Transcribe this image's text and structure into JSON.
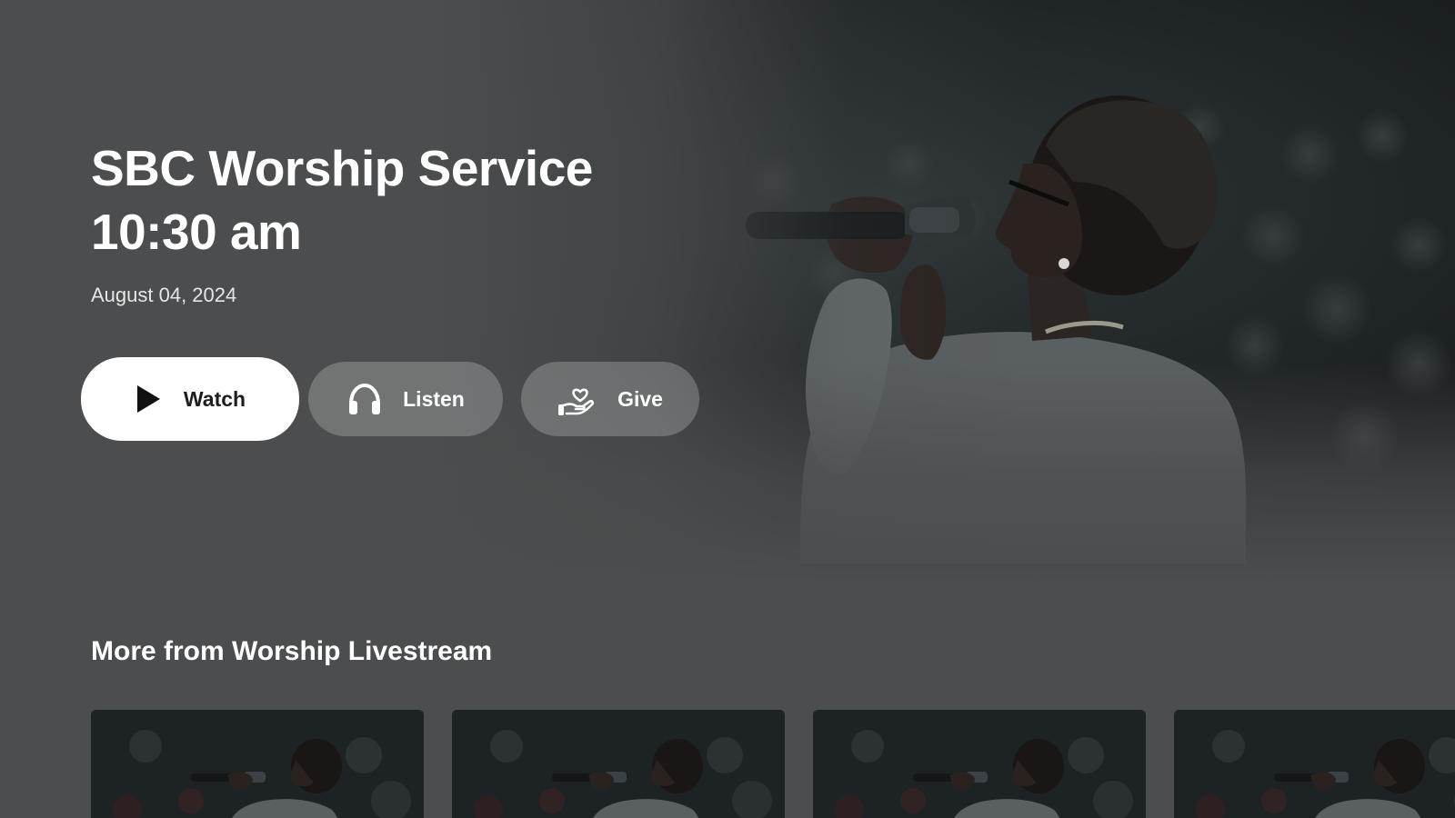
{
  "hero": {
    "title_line1": "SBC Worship Service",
    "title_line2": "10:30 am",
    "date": "August 04, 2024",
    "image": "singer-with-microphone"
  },
  "actions": {
    "watch_label": "Watch",
    "listen_label": "Listen",
    "give_label": "Give",
    "watch_icon": "play-icon",
    "listen_icon": "headphones-icon",
    "give_icon": "giving-hand-heart-icon"
  },
  "shelf": {
    "title": "More from Worship Livestream",
    "items": [
      {
        "thumbnail": "singer-with-microphone"
      },
      {
        "thumbnail": "singer-with-microphone"
      },
      {
        "thumbnail": "singer-with-microphone"
      },
      {
        "thumbnail": "singer-with-microphone"
      }
    ]
  },
  "colors": {
    "background": "#4b4d4e",
    "primary_button": "#ffffff",
    "secondary_button": "rgba(255,255,255,0.22)"
  }
}
